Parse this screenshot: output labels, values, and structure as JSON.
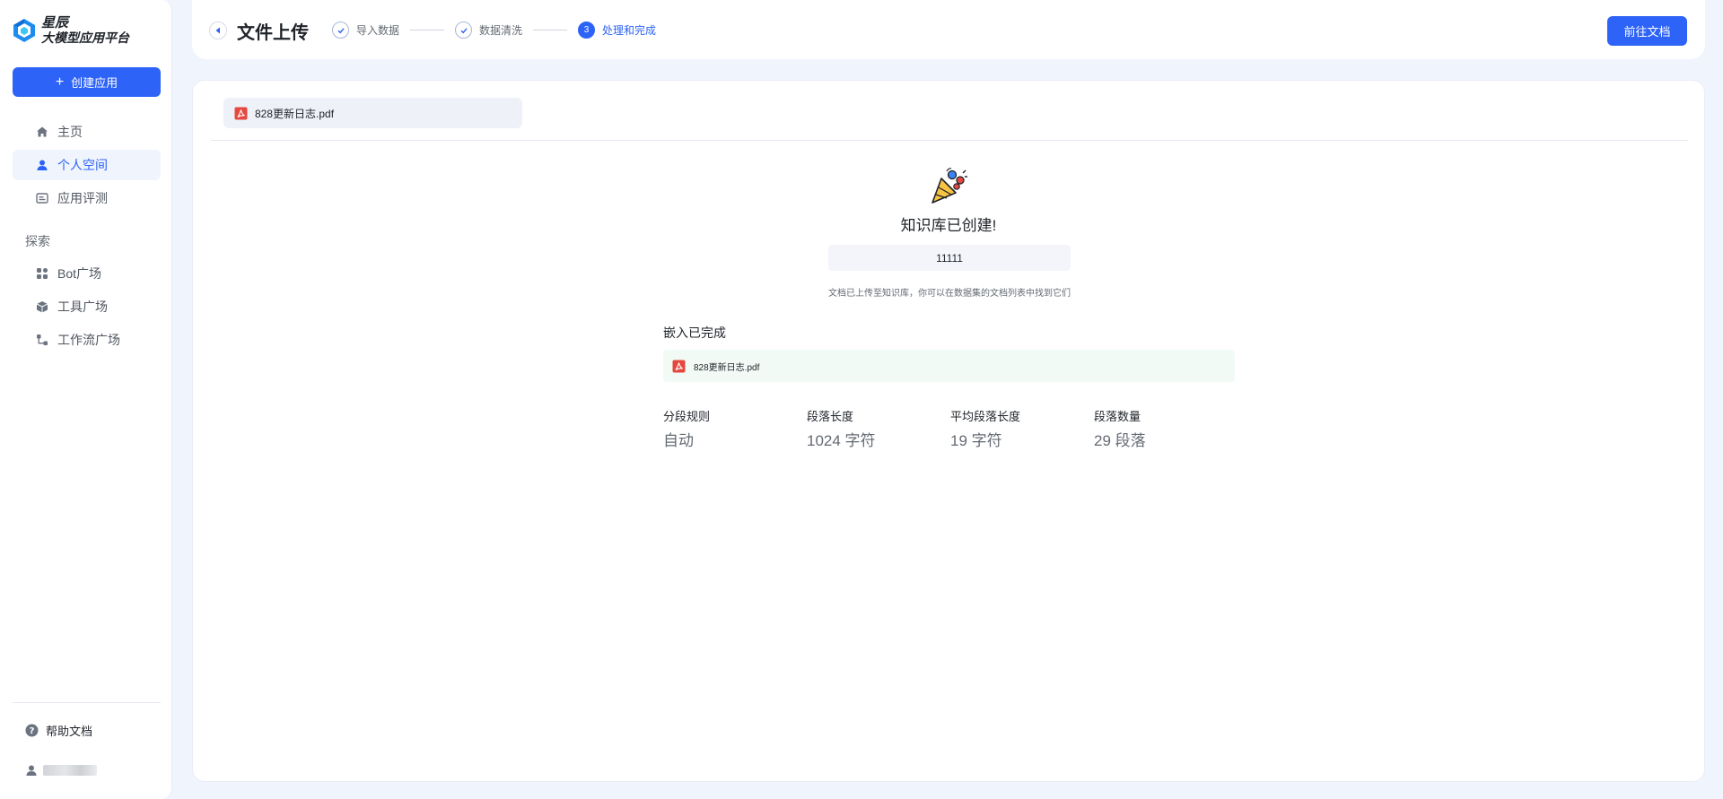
{
  "sidebar": {
    "logo": {
      "line1": "星辰",
      "line2": "大模型应用平台",
      "icon": "hexagon-logo-icon"
    },
    "create_button": "创建应用",
    "nav": [
      {
        "label": "主页",
        "icon": "home-icon",
        "active": false
      },
      {
        "label": "个人空间",
        "icon": "user-icon",
        "active": true
      },
      {
        "label": "应用评测",
        "icon": "evaluate-icon",
        "active": false
      }
    ],
    "explore_label": "探索",
    "explore": [
      {
        "label": "Bot广场",
        "icon": "grid-icon"
      },
      {
        "label": "工具广场",
        "icon": "cube-icon"
      },
      {
        "label": "工作流广场",
        "icon": "workflow-icon"
      }
    ],
    "help": "帮助文档"
  },
  "header": {
    "title": "文件上传",
    "steps": [
      {
        "label": "导入数据",
        "state": "done"
      },
      {
        "label": "数据清洗",
        "state": "done"
      },
      {
        "label": "处理和完成",
        "state": "active",
        "number": "3"
      }
    ],
    "goto_button": "前往文档"
  },
  "main": {
    "file_tab": "828更新日志.pdf",
    "success_title": "知识库已创建!",
    "kb_name": "11111",
    "hint": "文档已上传至知识库，你可以在数据集的文档列表中找到它们",
    "embed_title": "嵌入已完成",
    "embed_file": "828更新日志.pdf",
    "stats": [
      {
        "label": "分段规则",
        "value": "自动"
      },
      {
        "label": "段落长度",
        "value": "1024 字符"
      },
      {
        "label": "平均段落长度",
        "value": "19 字符"
      },
      {
        "label": "段落数量",
        "value": "29 段落"
      }
    ]
  },
  "colors": {
    "accent": "#2d63f6",
    "background": "#f0f4fd",
    "success_bg": "#f1faf5",
    "pdf_red": "#e5483f"
  }
}
